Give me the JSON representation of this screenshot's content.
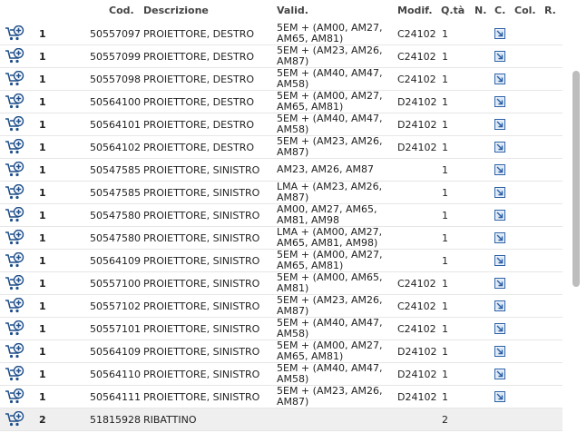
{
  "headers": {
    "cod": "Cod.",
    "descr": "Descrizione",
    "valid": "Valid.",
    "modif": "Modif.",
    "qta": "Q.tà",
    "n": "N.",
    "c": "C.",
    "col": "Col.",
    "r": "R."
  },
  "rows": [
    {
      "num": "1",
      "cod": "50557097",
      "descr": "PROIETTORE, DESTRO",
      "valid": "5EM + (AM00, AM27, AM65, AM81)",
      "modif": "C24102",
      "qta": "1",
      "link": true
    },
    {
      "num": "1",
      "cod": "50557099",
      "descr": "PROIETTORE, DESTRO",
      "valid": "5EM + (AM23, AM26, AM87)",
      "modif": "C24102",
      "qta": "1",
      "link": true
    },
    {
      "num": "1",
      "cod": "50557098",
      "descr": "PROIETTORE, DESTRO",
      "valid": "5EM + (AM40, AM47, AM58)",
      "modif": "C24102",
      "qta": "1",
      "link": true
    },
    {
      "num": "1",
      "cod": "50564100",
      "descr": "PROIETTORE, DESTRO",
      "valid": "5EM + (AM00, AM27, AM65, AM81)",
      "modif": "D24102",
      "qta": "1",
      "link": true
    },
    {
      "num": "1",
      "cod": "50564101",
      "descr": "PROIETTORE, DESTRO",
      "valid": "5EM + (AM40, AM47, AM58)",
      "modif": "D24102",
      "qta": "1",
      "link": true
    },
    {
      "num": "1",
      "cod": "50564102",
      "descr": "PROIETTORE, DESTRO",
      "valid": "5EM + (AM23, AM26, AM87)",
      "modif": "D24102",
      "qta": "1",
      "link": true
    },
    {
      "num": "1",
      "cod": "50547585",
      "descr": "PROIETTORE, SINISTRO",
      "valid": "AM23, AM26, AM87",
      "modif": "",
      "qta": "1",
      "link": true
    },
    {
      "num": "1",
      "cod": "50547585",
      "descr": "PROIETTORE, SINISTRO",
      "valid": "LMA + (AM23, AM26, AM87)",
      "modif": "",
      "qta": "1",
      "link": true
    },
    {
      "num": "1",
      "cod": "50547580",
      "descr": "PROIETTORE, SINISTRO",
      "valid": "AM00, AM27, AM65, AM81, AM98",
      "modif": "",
      "qta": "1",
      "link": true
    },
    {
      "num": "1",
      "cod": "50547580",
      "descr": "PROIETTORE, SINISTRO",
      "valid": "LMA + (AM00, AM27, AM65, AM81, AM98)",
      "modif": "",
      "qta": "1",
      "link": true
    },
    {
      "num": "1",
      "cod": "50564109",
      "descr": "PROIETTORE, SINISTRO",
      "valid": "5EM + (AM00, AM27, AM65, AM81)",
      "modif": "",
      "qta": "1",
      "link": true
    },
    {
      "num": "1",
      "cod": "50557100",
      "descr": "PROIETTORE, SINISTRO",
      "valid": "5EM + (AM00, AM65, AM81)",
      "modif": "C24102",
      "qta": "1",
      "link": true
    },
    {
      "num": "1",
      "cod": "50557102",
      "descr": "PROIETTORE, SINISTRO",
      "valid": "5EM + (AM23, AM26, AM87)",
      "modif": "C24102",
      "qta": "1",
      "link": true
    },
    {
      "num": "1",
      "cod": "50557101",
      "descr": "PROIETTORE, SINISTRO",
      "valid": "5EM + (AM40, AM47, AM58)",
      "modif": "C24102",
      "qta": "1",
      "link": true
    },
    {
      "num": "1",
      "cod": "50564109",
      "descr": "PROIETTORE, SINISTRO",
      "valid": "5EM + (AM00, AM27, AM65, AM81)",
      "modif": "D24102",
      "qta": "1",
      "link": true
    },
    {
      "num": "1",
      "cod": "50564110",
      "descr": "PROIETTORE, SINISTRO",
      "valid": "5EM + (AM40, AM47, AM58)",
      "modif": "D24102",
      "qta": "1",
      "link": true
    },
    {
      "num": "1",
      "cod": "50564111",
      "descr": "PROIETTORE, SINISTRO",
      "valid": "5EM + (AM23, AM26, AM87)",
      "modif": "D24102",
      "qta": "1",
      "link": true
    },
    {
      "num": "2",
      "cod": "51815928",
      "descr": "RIBATTINO",
      "valid": "",
      "modif": "",
      "qta": "2",
      "link": false
    }
  ],
  "colors": {
    "cart_icon": "#1f4f8a",
    "link_icon": "#2a5fa6",
    "last_row_bg": "#efefef",
    "scrollbar": "#bdbdbd"
  },
  "icons": {
    "row_action": "add-to-cart-icon",
    "row_link": "open-link-icon"
  }
}
